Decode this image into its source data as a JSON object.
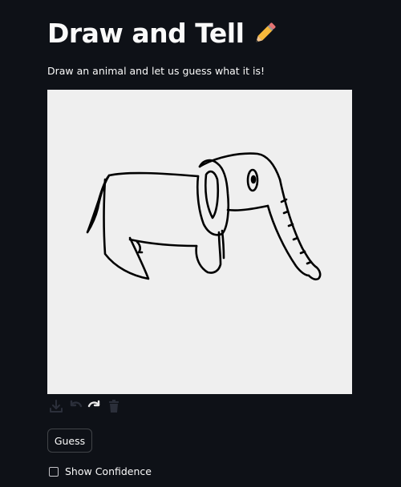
{
  "header": {
    "title": "Draw and Tell",
    "title_emoji": "pencil-icon"
  },
  "intro": {
    "text": "Draw an animal and let us guess what it is!"
  },
  "canvas": {
    "background": "#efefef",
    "stroke_color": "#000000",
    "drawing": "elephant"
  },
  "toolbar": {
    "icons": [
      "download-icon",
      "undo-icon",
      "redo-icon",
      "trash-icon"
    ]
  },
  "actions": {
    "guess_label": "Guess"
  },
  "options": {
    "show_confidence_label": "Show Confidence",
    "show_confidence_checked": false
  },
  "colors": {
    "background": "#0e1117",
    "text": "#fafafa",
    "pencil_body": "#f6b93b",
    "pencil_tip": "#f2c48d"
  }
}
